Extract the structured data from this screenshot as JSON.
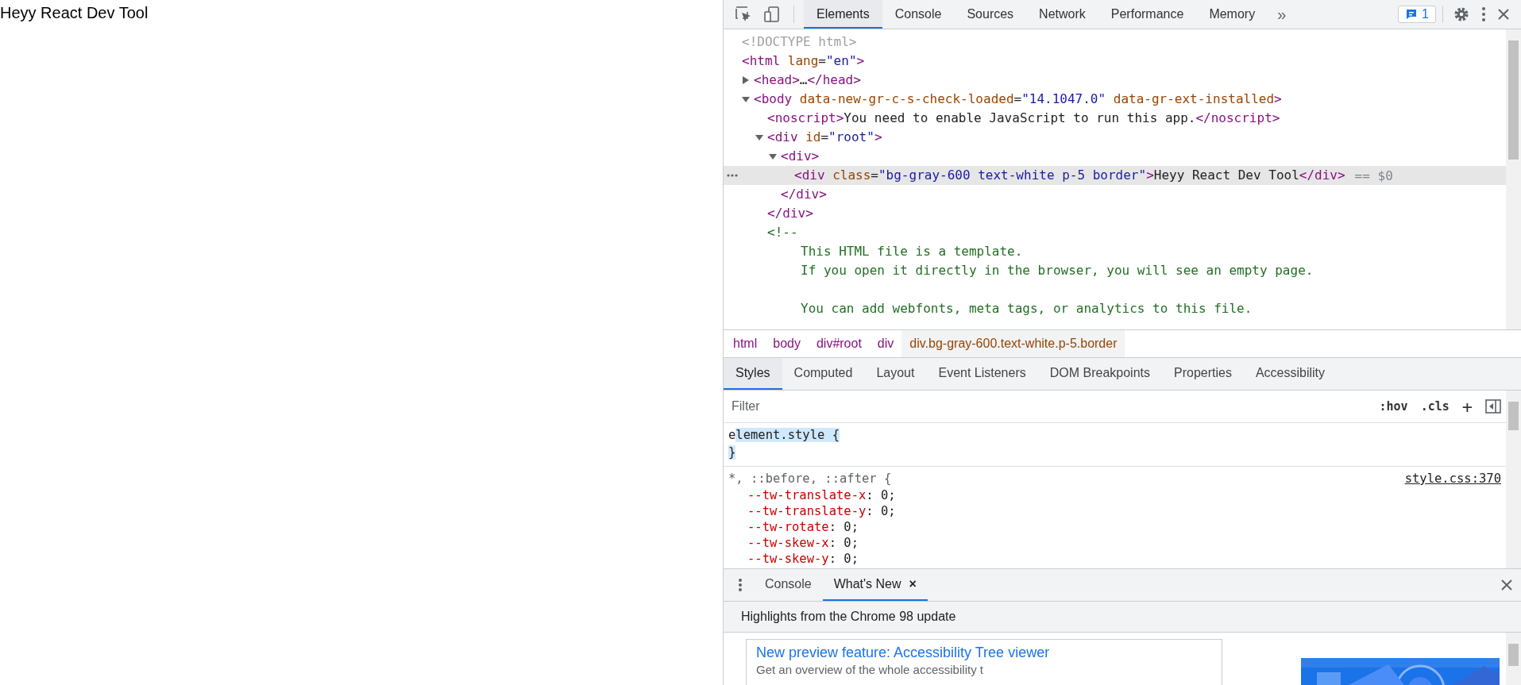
{
  "page": {
    "text": "Heyy React Dev Tool"
  },
  "toolbar": {
    "tabs": [
      {
        "label": "Elements",
        "selected": true
      },
      {
        "label": "Console",
        "selected": false
      },
      {
        "label": "Sources",
        "selected": false
      },
      {
        "label": "Network",
        "selected": false
      },
      {
        "label": "Performance",
        "selected": false
      },
      {
        "label": "Memory",
        "selected": false
      }
    ],
    "more": "»",
    "issues_count": "1"
  },
  "dom_tree": [
    {
      "tokens": [
        {
          "kind": "doctype",
          "text": "<!DOCTYPE html>"
        }
      ]
    },
    {
      "tokens": [
        {
          "kind": "tag",
          "text": "<html"
        },
        {
          "kind": "attr",
          "text": " lang"
        },
        {
          "kind": "punct",
          "text": "="
        },
        {
          "kind": "value",
          "text": "\"en\""
        },
        {
          "kind": "tag",
          "text": ">"
        }
      ],
      "children": [
        {
          "expanded": false,
          "tokens": [
            {
              "kind": "tag",
              "text": "<head>"
            },
            {
              "kind": "text",
              "text": "…"
            },
            {
              "kind": "tag",
              "text": "</head>"
            }
          ]
        },
        {
          "expanded": true,
          "tokens": [
            {
              "kind": "tag",
              "text": "<body"
            },
            {
              "kind": "attr",
              "text": " data-new-gr-c-s-check-loaded"
            },
            {
              "kind": "punct",
              "text": "="
            },
            {
              "kind": "value",
              "text": "\"14.1047.0\""
            },
            {
              "kind": "attr",
              "text": " data-gr-ext-installed"
            },
            {
              "kind": "tag",
              "text": ">"
            }
          ],
          "children": [
            {
              "tokens": [
                {
                  "kind": "tag",
                  "text": "<noscript>"
                },
                {
                  "kind": "text",
                  "text": "You need to enable JavaScript to run this app."
                },
                {
                  "kind": "tag",
                  "text": "</noscript>"
                }
              ]
            },
            {
              "expanded": true,
              "tokens": [
                {
                  "kind": "tag",
                  "text": "<div"
                },
                {
                  "kind": "attr",
                  "text": " id"
                },
                {
                  "kind": "punct",
                  "text": "="
                },
                {
                  "kind": "value",
                  "text": "\"root\""
                },
                {
                  "kind": "tag",
                  "text": ">"
                }
              ],
              "children": [
                {
                  "expanded": true,
                  "tokens": [
                    {
                      "kind": "tag",
                      "text": "<div>"
                    }
                  ],
                  "children": [
                    {
                      "selected": true,
                      "suffix": "== $0",
                      "tokens": [
                        {
                          "kind": "tag",
                          "text": "<div"
                        },
                        {
                          "kind": "attr",
                          "text": " class"
                        },
                        {
                          "kind": "punct",
                          "text": "="
                        },
                        {
                          "kind": "value",
                          "text": "\"bg-gray-600 text-white p-5 border\""
                        },
                        {
                          "kind": "tag",
                          "text": ">"
                        },
                        {
                          "kind": "text",
                          "text": "Heyy React Dev Tool"
                        },
                        {
                          "kind": "tag",
                          "text": "</div>"
                        }
                      ]
                    }
                  ],
                  "close": [
                    {
                      "kind": "tag",
                      "text": "</div>"
                    }
                  ]
                }
              ],
              "close": [
                {
                  "kind": "tag",
                  "text": "</div>"
                }
              ]
            },
            {
              "tokens": [
                {
                  "kind": "comment",
                  "text": "<!--"
                }
              ],
              "children": [
                {
                  "kind": "comment_line",
                  "tokens": [
                    {
                      "kind": "comment",
                      "text": "This HTML file is a template."
                    }
                  ]
                },
                {
                  "kind": "comment_line",
                  "tokens": [
                    {
                      "kind": "comment",
                      "text": "If you open it directly in the browser, you will see an empty page."
                    }
                  ]
                },
                {
                  "kind": "comment_line",
                  "blank_before": true,
                  "tokens": [
                    {
                      "kind": "comment",
                      "text": "You can add webfonts, meta tags, or analytics to this file."
                    }
                  ]
                }
              ]
            }
          ]
        }
      ]
    }
  ],
  "breadcrumbs": [
    {
      "label": "html",
      "selected": false
    },
    {
      "label": "body",
      "selected": false
    },
    {
      "label": "div#root",
      "selected": false
    },
    {
      "label": "div",
      "selected": false
    },
    {
      "label": "div.bg-gray-600.text-white.p-5.border",
      "selected": true
    }
  ],
  "sidebar_tabs": [
    {
      "label": "Styles",
      "selected": true
    },
    {
      "label": "Computed",
      "selected": false
    },
    {
      "label": "Layout",
      "selected": false
    },
    {
      "label": "Event Listeners",
      "selected": false
    },
    {
      "label": "DOM Breakpoints",
      "selected": false
    },
    {
      "label": "Properties",
      "selected": false
    },
    {
      "label": "Accessibility",
      "selected": false
    }
  ],
  "filter": {
    "placeholder": "Filter",
    "buttons": [
      ":hov",
      ".cls",
      "+"
    ]
  },
  "element_style": {
    "open": "element.style {",
    "close": "}",
    "text_selected": true
  },
  "rule": {
    "selector": "*, ::before, ::after {",
    "source": "style.css:370",
    "properties": [
      {
        "name": "--tw-translate-x",
        "rest": ": 0;"
      },
      {
        "name": "--tw-translate-y",
        "rest": ": 0;"
      },
      {
        "name": "--tw-rotate",
        "rest": ": 0;"
      },
      {
        "name": "--tw-skew-x",
        "rest": ": 0;"
      },
      {
        "name": "--tw-skew-y",
        "rest": ": 0;"
      }
    ]
  },
  "drawer": {
    "tabs": [
      {
        "label": "Console",
        "selected": false,
        "closable": false
      },
      {
        "label": "What's New",
        "selected": true,
        "closable": true
      }
    ],
    "close_glyph": "×",
    "heading": "Highlights from the Chrome 98 update",
    "card": {
      "title": "New preview feature: Accessibility Tree viewer",
      "subtitle": "Get an overview of the whole accessibility t"
    }
  }
}
